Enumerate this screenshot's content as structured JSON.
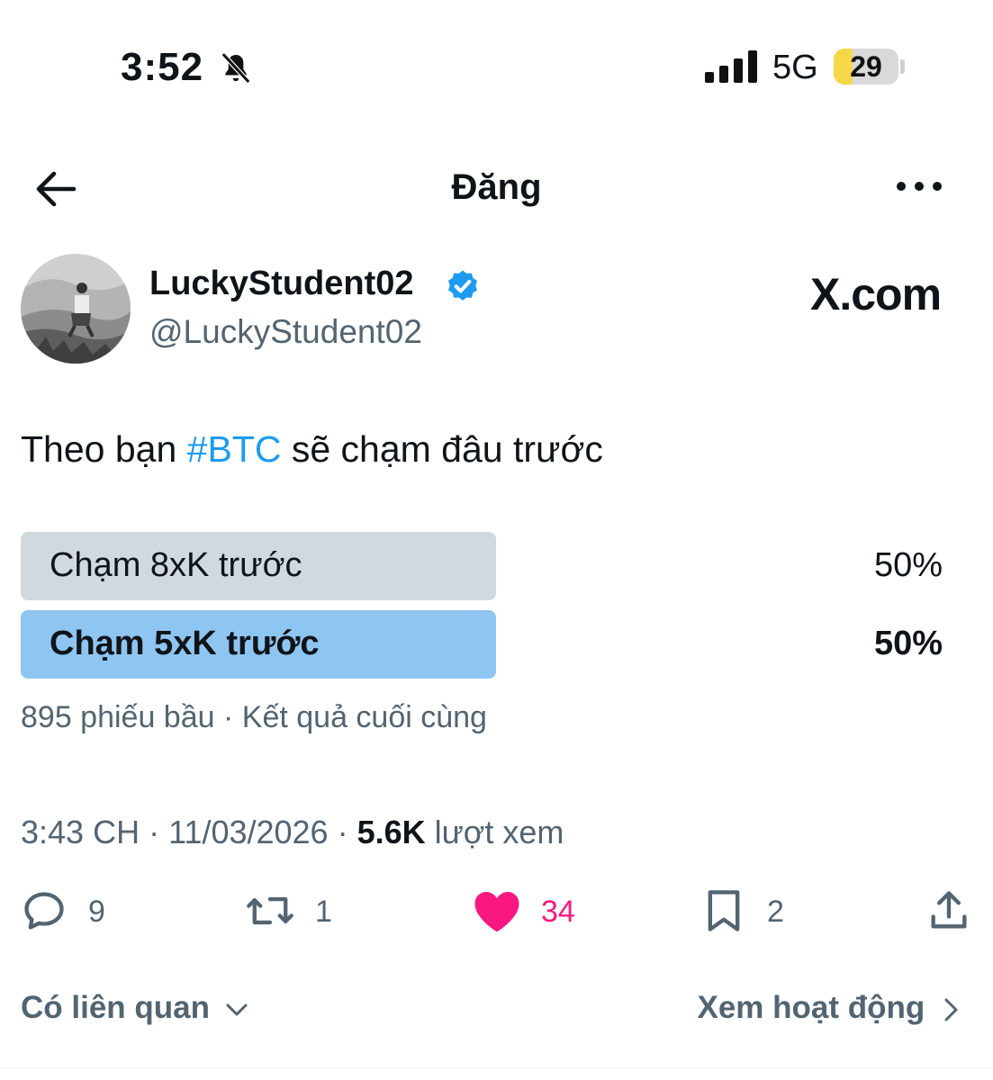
{
  "status_bar": {
    "time": "3:52",
    "network": "5G",
    "battery": "29",
    "battery_level": 0.29
  },
  "header": {
    "title": "Đăng"
  },
  "author": {
    "display_name": "LuckyStudent02",
    "handle": "@LuckyStudent02",
    "watermark": "X.com"
  },
  "tweet": {
    "text_before": "Theo bạn ",
    "hashtag": "#BTC",
    "text_after": " sẽ chạm đâu trước"
  },
  "poll": {
    "options": [
      {
        "label": "Chạm 8xK trước",
        "percent_label": "50%",
        "share": 0.5,
        "winner": false,
        "color": "#cfd9de"
      },
      {
        "label": "Chạm 5xK trước",
        "percent_label": "50%",
        "share": 0.5,
        "winner": true,
        "color": "#8ec5f1"
      }
    ],
    "votes": "895 phiếu bầu",
    "separator": " · ",
    "status": "Kết quả cuối cùng"
  },
  "meta": {
    "time": "3:43 CH",
    "separator": " · ",
    "date": "11/03/2026",
    "views_count": "5.6K",
    "views_label": " lượt xem"
  },
  "actions": {
    "replies": "9",
    "reposts": "1",
    "likes": "34",
    "bookmarks": "2",
    "like_color": "#f91880"
  },
  "footer": {
    "related": "Có liên quan",
    "activity": "Xem hoạt động"
  }
}
